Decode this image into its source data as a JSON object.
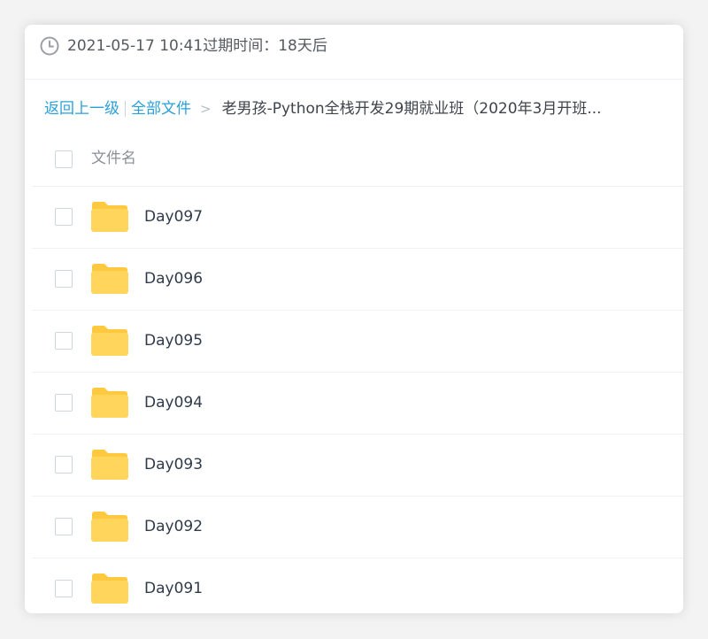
{
  "share": {
    "expiry_text": "2021-05-17 10:41过期时间：18天后",
    "clock_icon": "clock-icon"
  },
  "breadcrumb": {
    "back_label": "返回上一级",
    "all_files_label": "全部文件",
    "separator": ">",
    "current_folder": "老男孩-Python全栈开发29期就业班（2020年3月开班..."
  },
  "file_list": {
    "column_name": "文件名",
    "items": [
      {
        "name": "Day097",
        "icon": "folder-icon"
      },
      {
        "name": "Day096",
        "icon": "folder-icon"
      },
      {
        "name": "Day095",
        "icon": "folder-icon"
      },
      {
        "name": "Day094",
        "icon": "folder-icon"
      },
      {
        "name": "Day093",
        "icon": "folder-icon"
      },
      {
        "name": "Day092",
        "icon": "folder-icon"
      },
      {
        "name": "Day091",
        "icon": "folder-icon"
      }
    ]
  },
  "colors": {
    "link": "#2a9fd8",
    "folder": "#ffd55c",
    "folder_tab": "#ffc93f"
  }
}
